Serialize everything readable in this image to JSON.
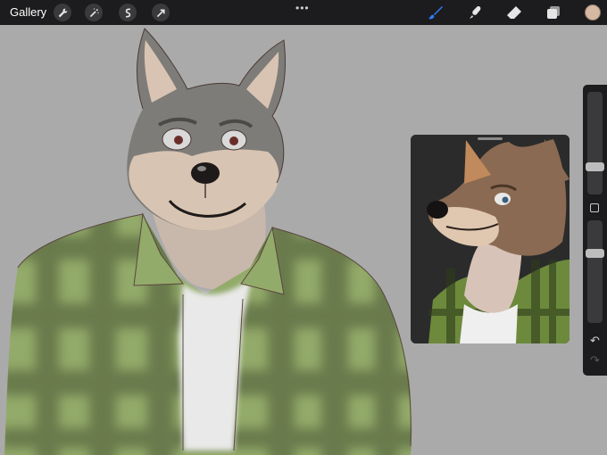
{
  "toolbar": {
    "gallery_label": "Gallery",
    "left_tools": [
      "wrench-icon",
      "magic-wand-icon",
      "selection-icon",
      "transform-arrow-icon"
    ],
    "more_label": "•••",
    "right_tools": [
      "brush-icon",
      "smudge-icon",
      "eraser-icon",
      "layers-icon"
    ],
    "active_tool": "brush-icon",
    "active_tool_color": "#2f7df6",
    "current_color": "#d6b9a2"
  },
  "sidebar": {
    "brush_size_level": 0.25,
    "opacity_level": 0.7,
    "undo_label": "↶",
    "redo_label": "↷"
  },
  "colors": {
    "canvas_bg": "#aaaaaa",
    "shirt_green": "#8fa865",
    "shirt_dark": "#5f6e44",
    "fur_gray": "#7d7c78",
    "fur_cream": "#d8c4b2"
  }
}
